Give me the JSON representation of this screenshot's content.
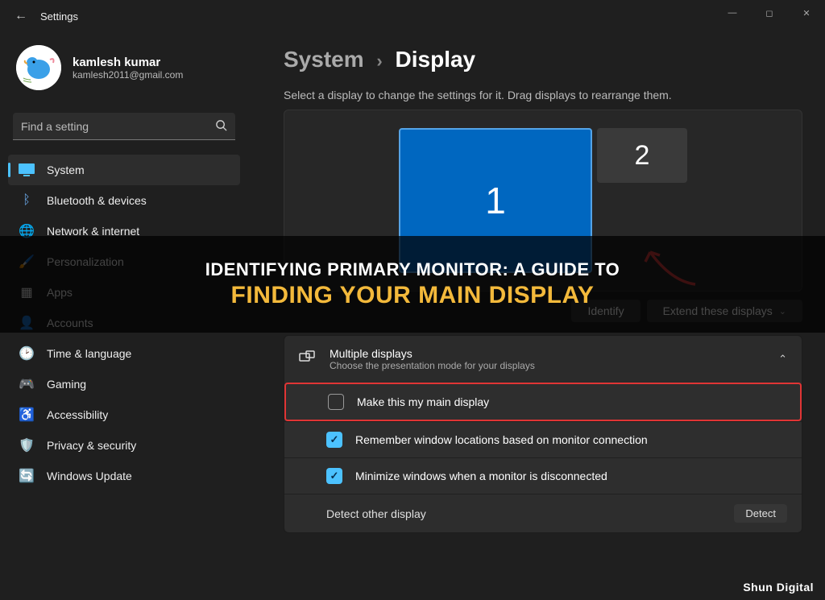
{
  "window": {
    "title": "Settings",
    "min": "—",
    "max": "◻",
    "close": "✕"
  },
  "profile": {
    "name": "kamlesh kumar",
    "email": "kamlesh2011@gmail.com"
  },
  "search": {
    "placeholder": "Find a setting"
  },
  "nav": [
    {
      "icon": "🖥️",
      "label": "System",
      "selected": true,
      "color": "#4cc2ff"
    },
    {
      "icon": "ᛒ",
      "label": "Bluetooth & devices",
      "selected": false,
      "color": "#6aa8e8"
    },
    {
      "icon": "🌐",
      "label": "Network & internet",
      "selected": false
    },
    {
      "icon": "🖌️",
      "label": "Personalization",
      "selected": false
    },
    {
      "icon": "▦",
      "label": "Apps",
      "selected": false
    },
    {
      "icon": "👤",
      "label": "Accounts",
      "selected": false
    },
    {
      "icon": "🕑",
      "label": "Time & language",
      "selected": false
    },
    {
      "icon": "🎮",
      "label": "Gaming",
      "selected": false
    },
    {
      "icon": "♿",
      "label": "Accessibility",
      "selected": false
    },
    {
      "icon": "🛡️",
      "label": "Privacy & security",
      "selected": false
    },
    {
      "icon": "🔄",
      "label": "Windows Update",
      "selected": false
    }
  ],
  "breadcrumb": {
    "parent": "System",
    "current": "Display"
  },
  "hint": "Select a display to change the settings for it. Drag displays to rearrange them.",
  "monitors": {
    "m1": "1",
    "m2": "2"
  },
  "actions": {
    "identify": "Identify",
    "extend": "Extend these displays"
  },
  "card": {
    "title": "Multiple displays",
    "sub": "Choose the presentation mode for your displays",
    "opt_main": "Make this my main display",
    "opt_remember": "Remember window locations based on monitor connection",
    "opt_minimize": "Minimize windows when a monitor is disconnected",
    "opt_detect": "Detect other display",
    "detect_btn": "Detect"
  },
  "overlay": {
    "line1": "IDENTIFYING PRIMARY MONITOR: A GUIDE TO",
    "line2": "FINDING YOUR MAIN DISPLAY"
  },
  "watermark": "Shun Digital"
}
